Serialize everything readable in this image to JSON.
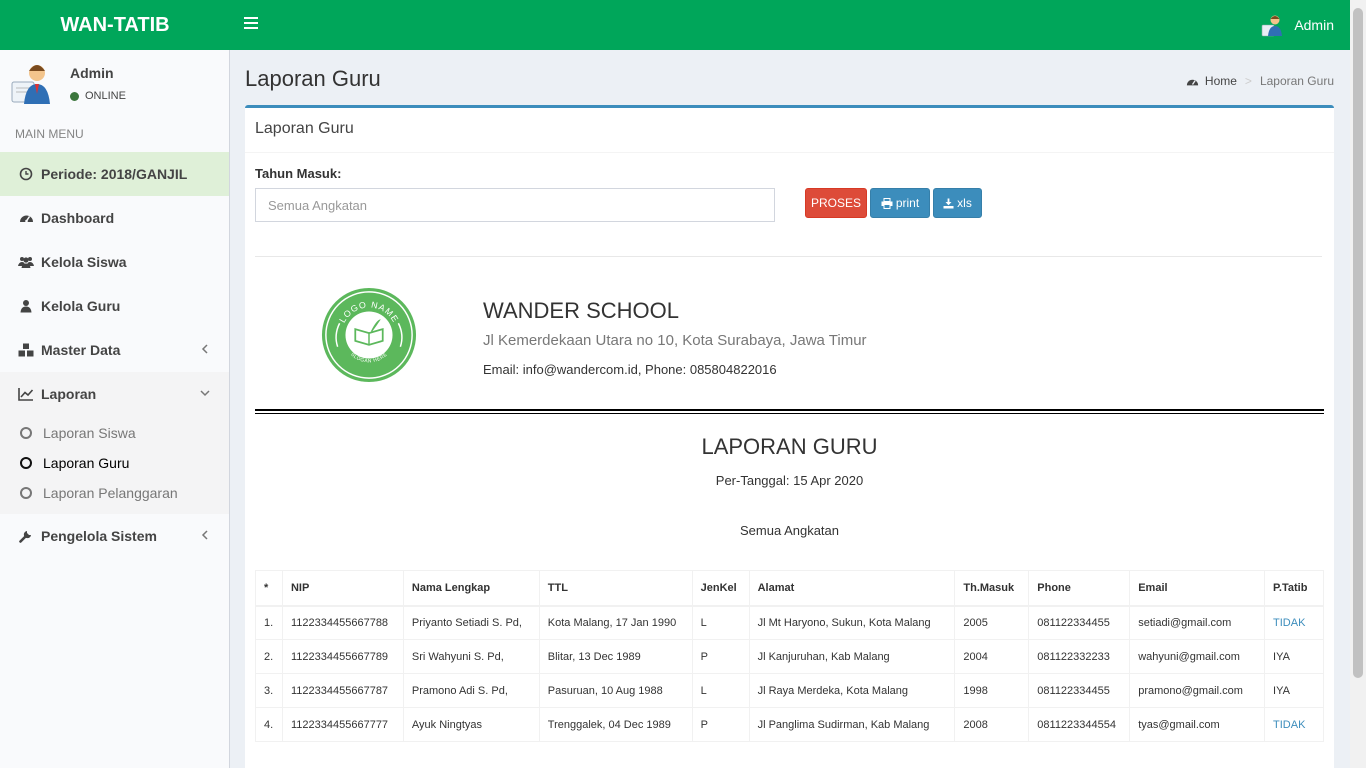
{
  "app": {
    "brand": "WAN-TATIB",
    "top_user": "Admin"
  },
  "sidebar": {
    "user_name": "Admin",
    "user_status": "ONLINE",
    "menu_header": "MAIN MENU",
    "items": [
      {
        "label": "Periode: 2018/GANJIL",
        "icon": "clock-icon"
      },
      {
        "label": "Dashboard",
        "icon": "dashboard-icon"
      },
      {
        "label": "Kelola Siswa",
        "icon": "users-icon"
      },
      {
        "label": "Kelola Guru",
        "icon": "user-icon"
      },
      {
        "label": "Master Data",
        "icon": "cubes-icon"
      },
      {
        "label": "Laporan",
        "icon": "line-chart-icon"
      },
      {
        "label": "Pengelola Sistem",
        "icon": "wrench-icon"
      }
    ],
    "laporan_sub": [
      {
        "label": "Laporan Siswa"
      },
      {
        "label": "Laporan Guru"
      },
      {
        "label": "Laporan Pelanggaran"
      }
    ]
  },
  "page": {
    "title": "Laporan Guru",
    "breadcrumb_home": "Home",
    "breadcrumb_current": "Laporan Guru"
  },
  "box": {
    "title": "Laporan Guru",
    "tahun_label": "Tahun Masuk:",
    "tahun_placeholder": "Semua Angkatan",
    "btn_proses": "PROSES",
    "btn_print": "print",
    "btn_xls": "xls"
  },
  "school": {
    "name": "WANDER SCHOOL",
    "address": "Jl Kemerdekaan Utara no 10, Kota Surabaya, Jawa Timur",
    "contact": "Email: info@wandercom.id, Phone: 085804822016",
    "logo_top": "LOGO NAME",
    "logo_bottom": "SLOGAN HERE"
  },
  "report": {
    "title": "LAPORAN GURU",
    "date": "Per-Tanggal: 15 Apr 2020",
    "angkatan": "Semua Angkatan"
  },
  "table": {
    "headers": [
      "*",
      "NIP",
      "Nama Lengkap",
      "TTL",
      "JenKel",
      "Alamat",
      "Th.Masuk",
      "Phone",
      "Email",
      "P.Tatib"
    ],
    "rows": [
      [
        "1.",
        "1122334455667788",
        "Priyanto Setiadi S. Pd,",
        "Kota Malang, 17 Jan 1990",
        "L",
        "Jl Mt Haryono, Sukun, Kota Malang",
        "2005",
        "081122334455",
        "setiadi@gmail.com",
        "TIDAK"
      ],
      [
        "2.",
        "1122334455667789",
        "Sri Wahyuni S. Pd,",
        "Blitar, 13 Dec 1989",
        "P",
        "Jl Kanjuruhan, Kab Malang",
        "2004",
        "081122332233",
        "wahyuni@gmail.com",
        "IYA"
      ],
      [
        "3.",
        "1122334455667787",
        "Pramono Adi S. Pd,",
        "Pasuruan, 10 Aug 1988",
        "L",
        "Jl Raya Merdeka, Kota Malang",
        "1998",
        "081122334455",
        "pramono@gmail.com",
        "IYA"
      ],
      [
        "4.",
        "1122334455667777",
        "Ayuk Ningtyas",
        "Trenggalek, 04 Dec 1989",
        "P",
        "Jl Panglima Sudirman, Kab Malang",
        "2008",
        "0811223344554",
        "tyas@gmail.com",
        "TIDAK"
      ]
    ]
  },
  "colors": {
    "header_green": "#00a65a",
    "box_blue": "#3c8dbc",
    "proses_red": "#dd4b39",
    "periode_bg": "#dff0d8"
  }
}
